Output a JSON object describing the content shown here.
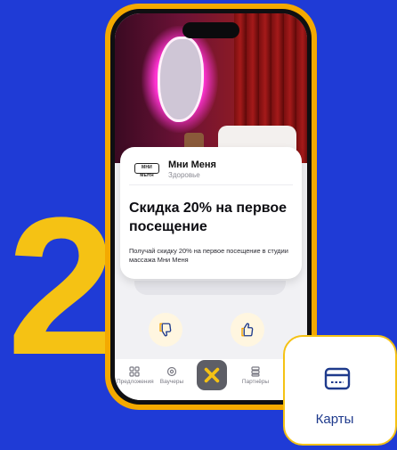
{
  "step": {
    "number": "2"
  },
  "merchant": {
    "name": "Мни Меня",
    "category": "Здоровье",
    "logo_text": "МНИ МЕНЯ"
  },
  "offer": {
    "title": "Скидка 20% на первое посещение",
    "description": "Получай скидку 20% на первое посещение в студии массажа Мни Меня"
  },
  "reactions": [
    {
      "icon": "thumbs-down-icon"
    },
    {
      "icon": "thumbs-up-icon"
    }
  ],
  "tabbar": {
    "items": [
      {
        "label": "Предложения",
        "icon": "grid-icon"
      },
      {
        "label": "Ваучеры",
        "icon": "gear-badge-icon"
      },
      {
        "label": "",
        "icon": "cross-logo-icon"
      },
      {
        "label": "Партнёры",
        "icon": "stack-icon"
      }
    ]
  },
  "cards_badge": {
    "label": "Карты",
    "icon": "credit-card-icon"
  },
  "colors": {
    "background": "#1f3bd6",
    "accent_yellow": "#f5c214",
    "phone_frame": "#f4a900",
    "card_icon": "#1e3a8c"
  }
}
